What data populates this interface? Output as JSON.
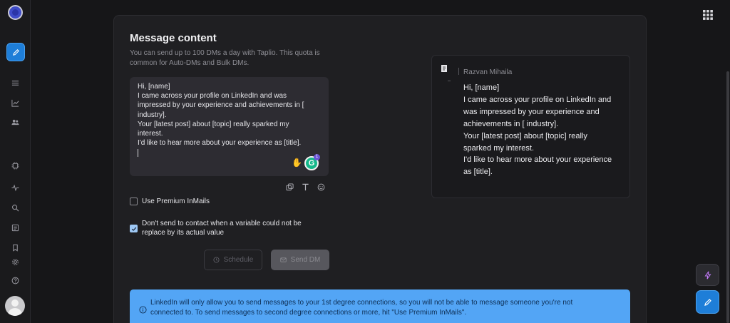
{
  "message_content": {
    "title": "Message content",
    "subtitle": "You can send up to 100 DMs a day with Taplio. This quota is common for Auto-DMs and Bulk DMs.",
    "editor_lines": [
      "Hi, [name]",
      "I came across your profile on LinkedIn and was",
      "impressed by your experience and achievements in [",
      "industry].",
      "Your [latest post] about [topic] really sparked my",
      "interest.",
      "I'd like to hear more about your experience as [title]."
    ],
    "grammarly_count": "1",
    "options": {
      "premium_inmails": {
        "label": "Use Premium InMails",
        "checked": false
      },
      "skip_missing_variable": {
        "label_line1": "Don't send to contact when a variable could not be",
        "label_line2": "replace by its actual value",
        "checked": true
      }
    },
    "buttons": {
      "schedule": "Schedule",
      "send": "Send DM"
    }
  },
  "preview": {
    "sender_name": "Razvan Mihaila",
    "lines": [
      "Hi, [name]",
      "I came across your profile on LinkedIn and",
      "was impressed by your experience and",
      "achievements in [ industry].",
      "Your [latest post] about [topic] really",
      "sparked my interest.",
      "I'd like to hear more about your experience",
      "as [title]."
    ]
  },
  "info_banner": {
    "line1": "LinkedIn will only allow you to send messages to your 1st degree connections, so you will not be able to message someone you're not",
    "line2": "connected to. To send messages to second degree connections or more, hit \"Use Premium InMails\"."
  },
  "colors": {
    "accent": "#1e7ed8",
    "banner": "#53a5f5",
    "panel": "#1f1f22",
    "editor": "#2d2c32"
  },
  "icons": {
    "sidebar": [
      "logo-icon",
      "pencil-icon",
      "list-icon",
      "chart-icon",
      "users-icon",
      "chip-icon",
      "activity-icon",
      "search-icon",
      "newspaper-icon",
      "bookmark-icon",
      "gear-icon",
      "help-icon"
    ],
    "toolbar": [
      "copy-icon",
      "text-format-icon",
      "emoji-icon"
    ]
  }
}
